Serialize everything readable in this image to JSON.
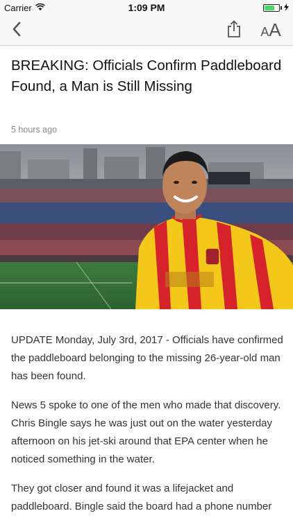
{
  "status_bar": {
    "carrier": "Carrier",
    "time": "1:09 PM",
    "battery_level": 0.7,
    "battery_color": "#4cd964"
  },
  "nav": {
    "back_icon": "chevron-left-icon",
    "share_icon": "share-icon",
    "font_size_icon": "font-size-icon",
    "font_small": "A",
    "font_large": "A"
  },
  "article": {
    "headline": "BREAKING: Officials Confirm Paddleboard Found, a Man is Still Missing",
    "timestamp": "5 hours ago",
    "paragraphs": [
      "UPDATE  Monday, July 3rd, 2017 - Officials have confirmed the paddleboard belonging to the missing 26-year-old man has been found.",
      "News 5 spoke to one of the men who made that discovery.  Chris Bingle says he was just out on the water yesterday afternoon on his jet-ski around that EPA center when he noticed something in the water.",
      "They got closer and found it was a lifejacket and paddleboard. Bingle said the board had a phone number and that's how he got in contact with the missing man's"
    ]
  }
}
